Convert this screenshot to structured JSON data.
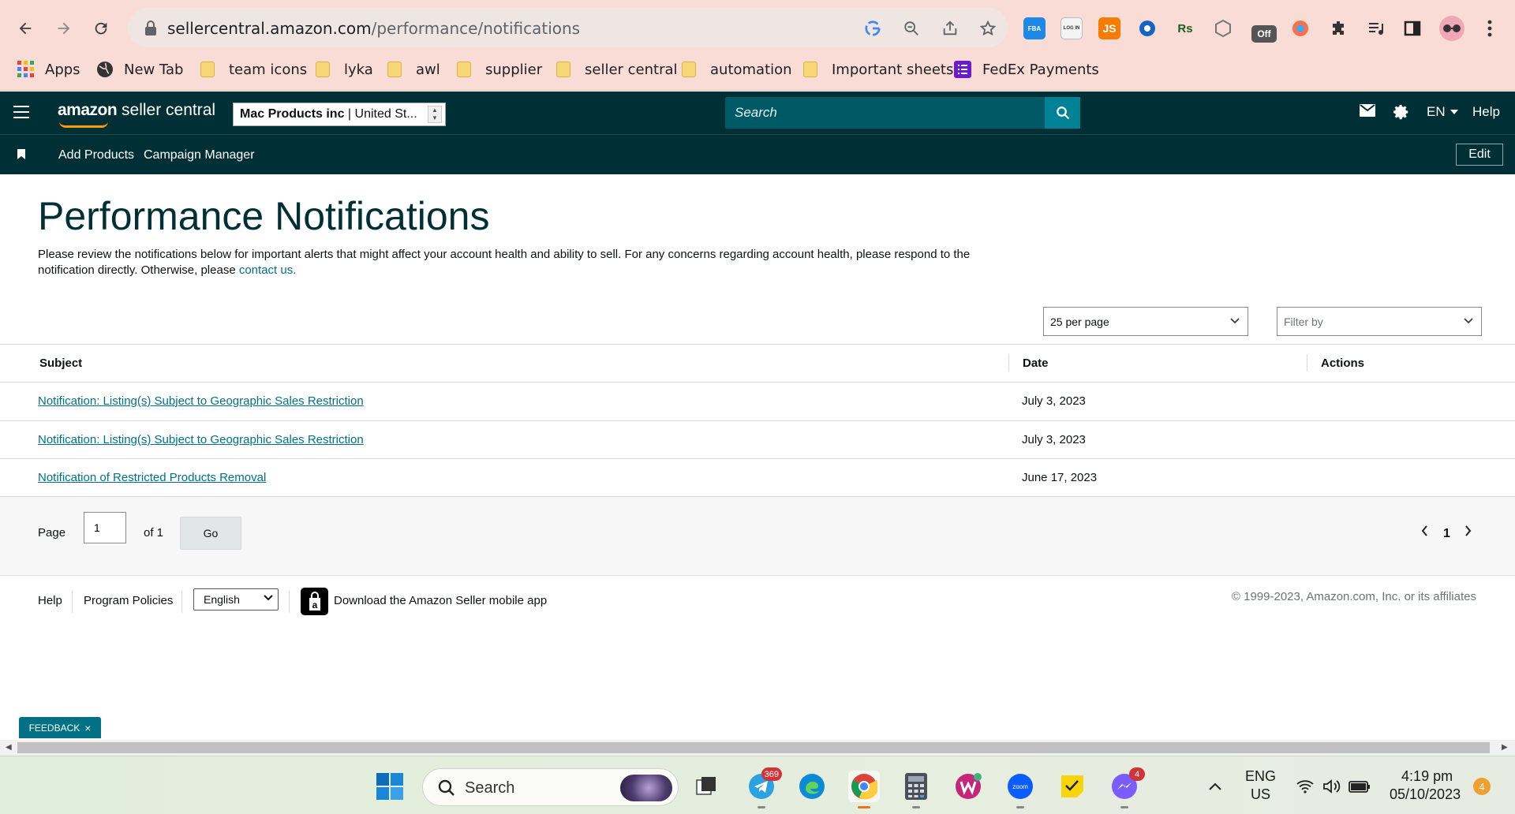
{
  "browser": {
    "url_domain": "sellercentral.amazon.com",
    "url_path": "/performance/notifications",
    "extensions": [
      "FBA",
      "LOG IN",
      "JS",
      "Rs",
      "Off"
    ],
    "bookmarks": [
      "Apps",
      "New Tab",
      "team icons",
      "lyka",
      "awl",
      "supplier",
      "seller central",
      "automation",
      "Important sheets",
      "FedEx Payments"
    ]
  },
  "header": {
    "logo_amazon": "amazon",
    "logo_rest": " seller central",
    "account_name": "Mac Products inc",
    "account_region": " | United St...",
    "search_placeholder": "Search",
    "language": "EN",
    "help": "Help"
  },
  "subnav": {
    "items": [
      "Add Products",
      "Campaign Manager"
    ],
    "edit_label": "Edit"
  },
  "page": {
    "title": "Performance Notifications",
    "intro": "Please review the notifications below for important alerts that might affect your account health and ability to sell. For any concerns regarding account health, please respond to the notification directly. Otherwise, please ",
    "intro_link": "contact us.",
    "per_page": "25 per page",
    "filter_placeholder": "Filter by"
  },
  "table": {
    "columns": [
      "Subject",
      "Date",
      "Actions"
    ],
    "rows": [
      {
        "subject": "Notification: Listing(s) Subject to Geographic Sales Restriction",
        "date": "July 3, 2023"
      },
      {
        "subject": "Notification: Listing(s) Subject to Geographic Sales Restriction",
        "date": "July 3, 2023"
      },
      {
        "subject": "Notification of Restricted Products Removal",
        "date": "June 17, 2023"
      }
    ]
  },
  "pager": {
    "page_label": "Page",
    "page_value": "1",
    "of_label": "of 1",
    "go_label": "Go",
    "current": "1"
  },
  "footer": {
    "help": "Help",
    "program_policies": "Program Policies",
    "language": "English",
    "app_text": "Download the Amazon Seller mobile app",
    "copyright": "© 1999-2023, Amazon.com, Inc. or its affiliates"
  },
  "feedback": "FEEDBACK",
  "taskbar": {
    "search": "Search",
    "telegram_badge": "369",
    "messenger_badge": "4",
    "lang_top": "ENG",
    "lang_bottom": "US",
    "time": "4:19 pm",
    "date": "05/10/2023",
    "notif_count": "4"
  }
}
